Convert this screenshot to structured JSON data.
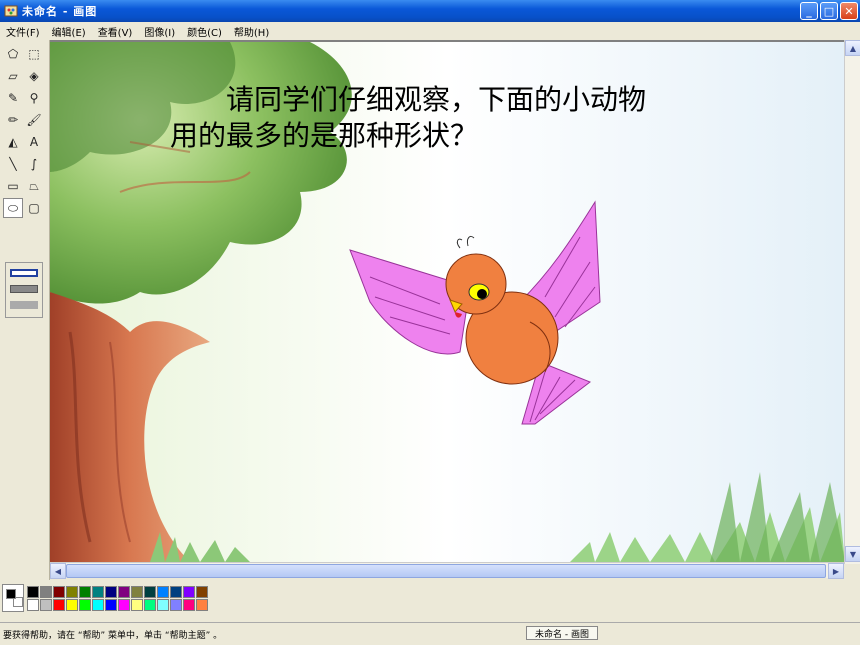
{
  "window": {
    "title": "未命名 - 画图",
    "buttons": {
      "minimize": "_",
      "maximize": "□",
      "close": "✕"
    }
  },
  "menu": [
    "文件(F)",
    "编辑(E)",
    "查看(V)",
    "图像(I)",
    "颜色(C)",
    "帮助(H)"
  ],
  "tools": [
    {
      "name": "free-select-icon",
      "glyph": "⬠"
    },
    {
      "name": "rect-select-icon",
      "glyph": "⬚"
    },
    {
      "name": "eraser-icon",
      "glyph": "▱"
    },
    {
      "name": "fill-bucket-icon",
      "glyph": "◈"
    },
    {
      "name": "color-picker-icon",
      "glyph": "✎"
    },
    {
      "name": "magnifier-icon",
      "glyph": "⚲"
    },
    {
      "name": "pencil-icon",
      "glyph": "✏"
    },
    {
      "name": "brush-icon",
      "glyph": "🖌"
    },
    {
      "name": "airbrush-icon",
      "glyph": "◭"
    },
    {
      "name": "text-icon",
      "glyph": "A"
    },
    {
      "name": "line-icon",
      "glyph": "╲"
    },
    {
      "name": "curve-icon",
      "glyph": "∫"
    },
    {
      "name": "rectangle-icon",
      "glyph": "▭"
    },
    {
      "name": "polygon-icon",
      "glyph": "⏢"
    },
    {
      "name": "ellipse-icon",
      "glyph": "⬭"
    },
    {
      "name": "rounded-rect-icon",
      "glyph": "▢"
    }
  ],
  "selected_tool": "ellipse-icon",
  "canvas": {
    "prompt_line1": "请同学们仔细观察，下面的小动物",
    "prompt_line2": "用的最多的是那种形状？"
  },
  "palette": {
    "foreground": "#000000",
    "background": "#ffffff",
    "colors_row1": [
      "#000000",
      "#808080",
      "#800000",
      "#808000",
      "#008000",
      "#008080",
      "#000080",
      "#800080",
      "#808040",
      "#004040",
      "#0080ff",
      "#004080",
      "#8000ff",
      "#804000"
    ],
    "colors_row2": [
      "#ffffff",
      "#c0c0c0",
      "#ff0000",
      "#ffff00",
      "#00ff00",
      "#00ffff",
      "#0000ff",
      "#ff00ff",
      "#ffff80",
      "#00ff80",
      "#80ffff",
      "#8080ff",
      "#ff0080",
      "#ff8040"
    ]
  },
  "status": {
    "help_text": "要获得帮助，请在 “帮助” 菜单中，单击 “帮助主题” 。",
    "task_label": "未命名 - 画图"
  }
}
